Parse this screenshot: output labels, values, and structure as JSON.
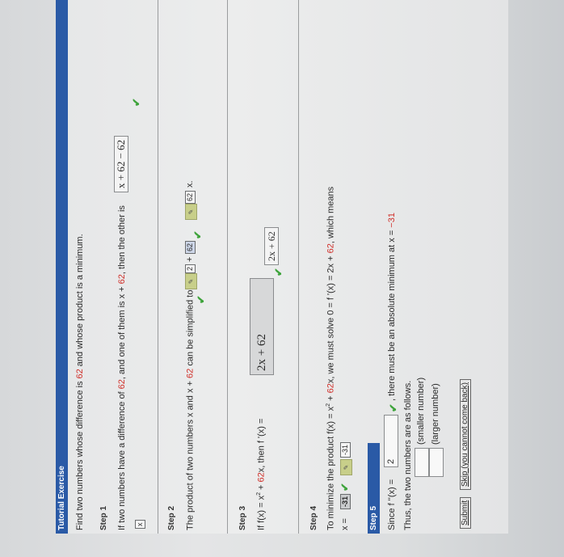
{
  "header": {
    "title": "Tutorial Exercise"
  },
  "problem": {
    "text": "Find two numbers whose difference is ",
    "n1": "62",
    "rest": " and whose product is a minimum."
  },
  "step1": {
    "label": "Step 1",
    "t1": "If two numbers have a difference of ",
    "n1": "62",
    "t2": ", and one of them is x + ",
    "n2": "62",
    "t3": ", then the other is",
    "answer": "x + 62 − 62",
    "box": "x"
  },
  "step2": {
    "label": "Step 2",
    "t1": "The product of two numbers x and x + ",
    "n1": "62",
    "t2": " can be simplified to be x",
    "exp": "2",
    "exp_box": "2",
    "plus": "+",
    "coef_box": "62",
    "answer_box": "62",
    "var": "x."
  },
  "step3": {
    "label": "Step 3",
    "t1": "If  f(x) = x",
    "t1b": " + ",
    "n1": "62",
    "t2": "x,  then  f '(x) =",
    "answer": "2x + 62",
    "answer_small": "2x + 62"
  },
  "step4": {
    "label": "Step 4",
    "t1": "To minimize the product  f(x) = x",
    "t1b": " + ",
    "n1": "62",
    "t2": "x,  we must solve  0 = f '(x) = 2x + ",
    "n2": "62",
    "t3": ", which means",
    "xeq": "x =",
    "xval": "-31",
    "xval2": "-31"
  },
  "step5": {
    "label": "Step 5",
    "since": "Since  f ''(x) =",
    "since_val": "2",
    "since_rest": ",  there must be an absolute minimum at x = ",
    "since_x": "−31",
    "thus": "Thus, the two numbers are as follows.",
    "smaller": "(smaller number)",
    "larger": "(larger number)"
  },
  "buttons": {
    "submit": "Submit",
    "skip": "Skip (you cannot come back)"
  },
  "icons": {
    "check": "check-icon",
    "pencil": "pencil-icon"
  },
  "colors": {
    "header": "#2a5aa6",
    "accent_red": "#d0302a",
    "check": "#3da33a"
  }
}
